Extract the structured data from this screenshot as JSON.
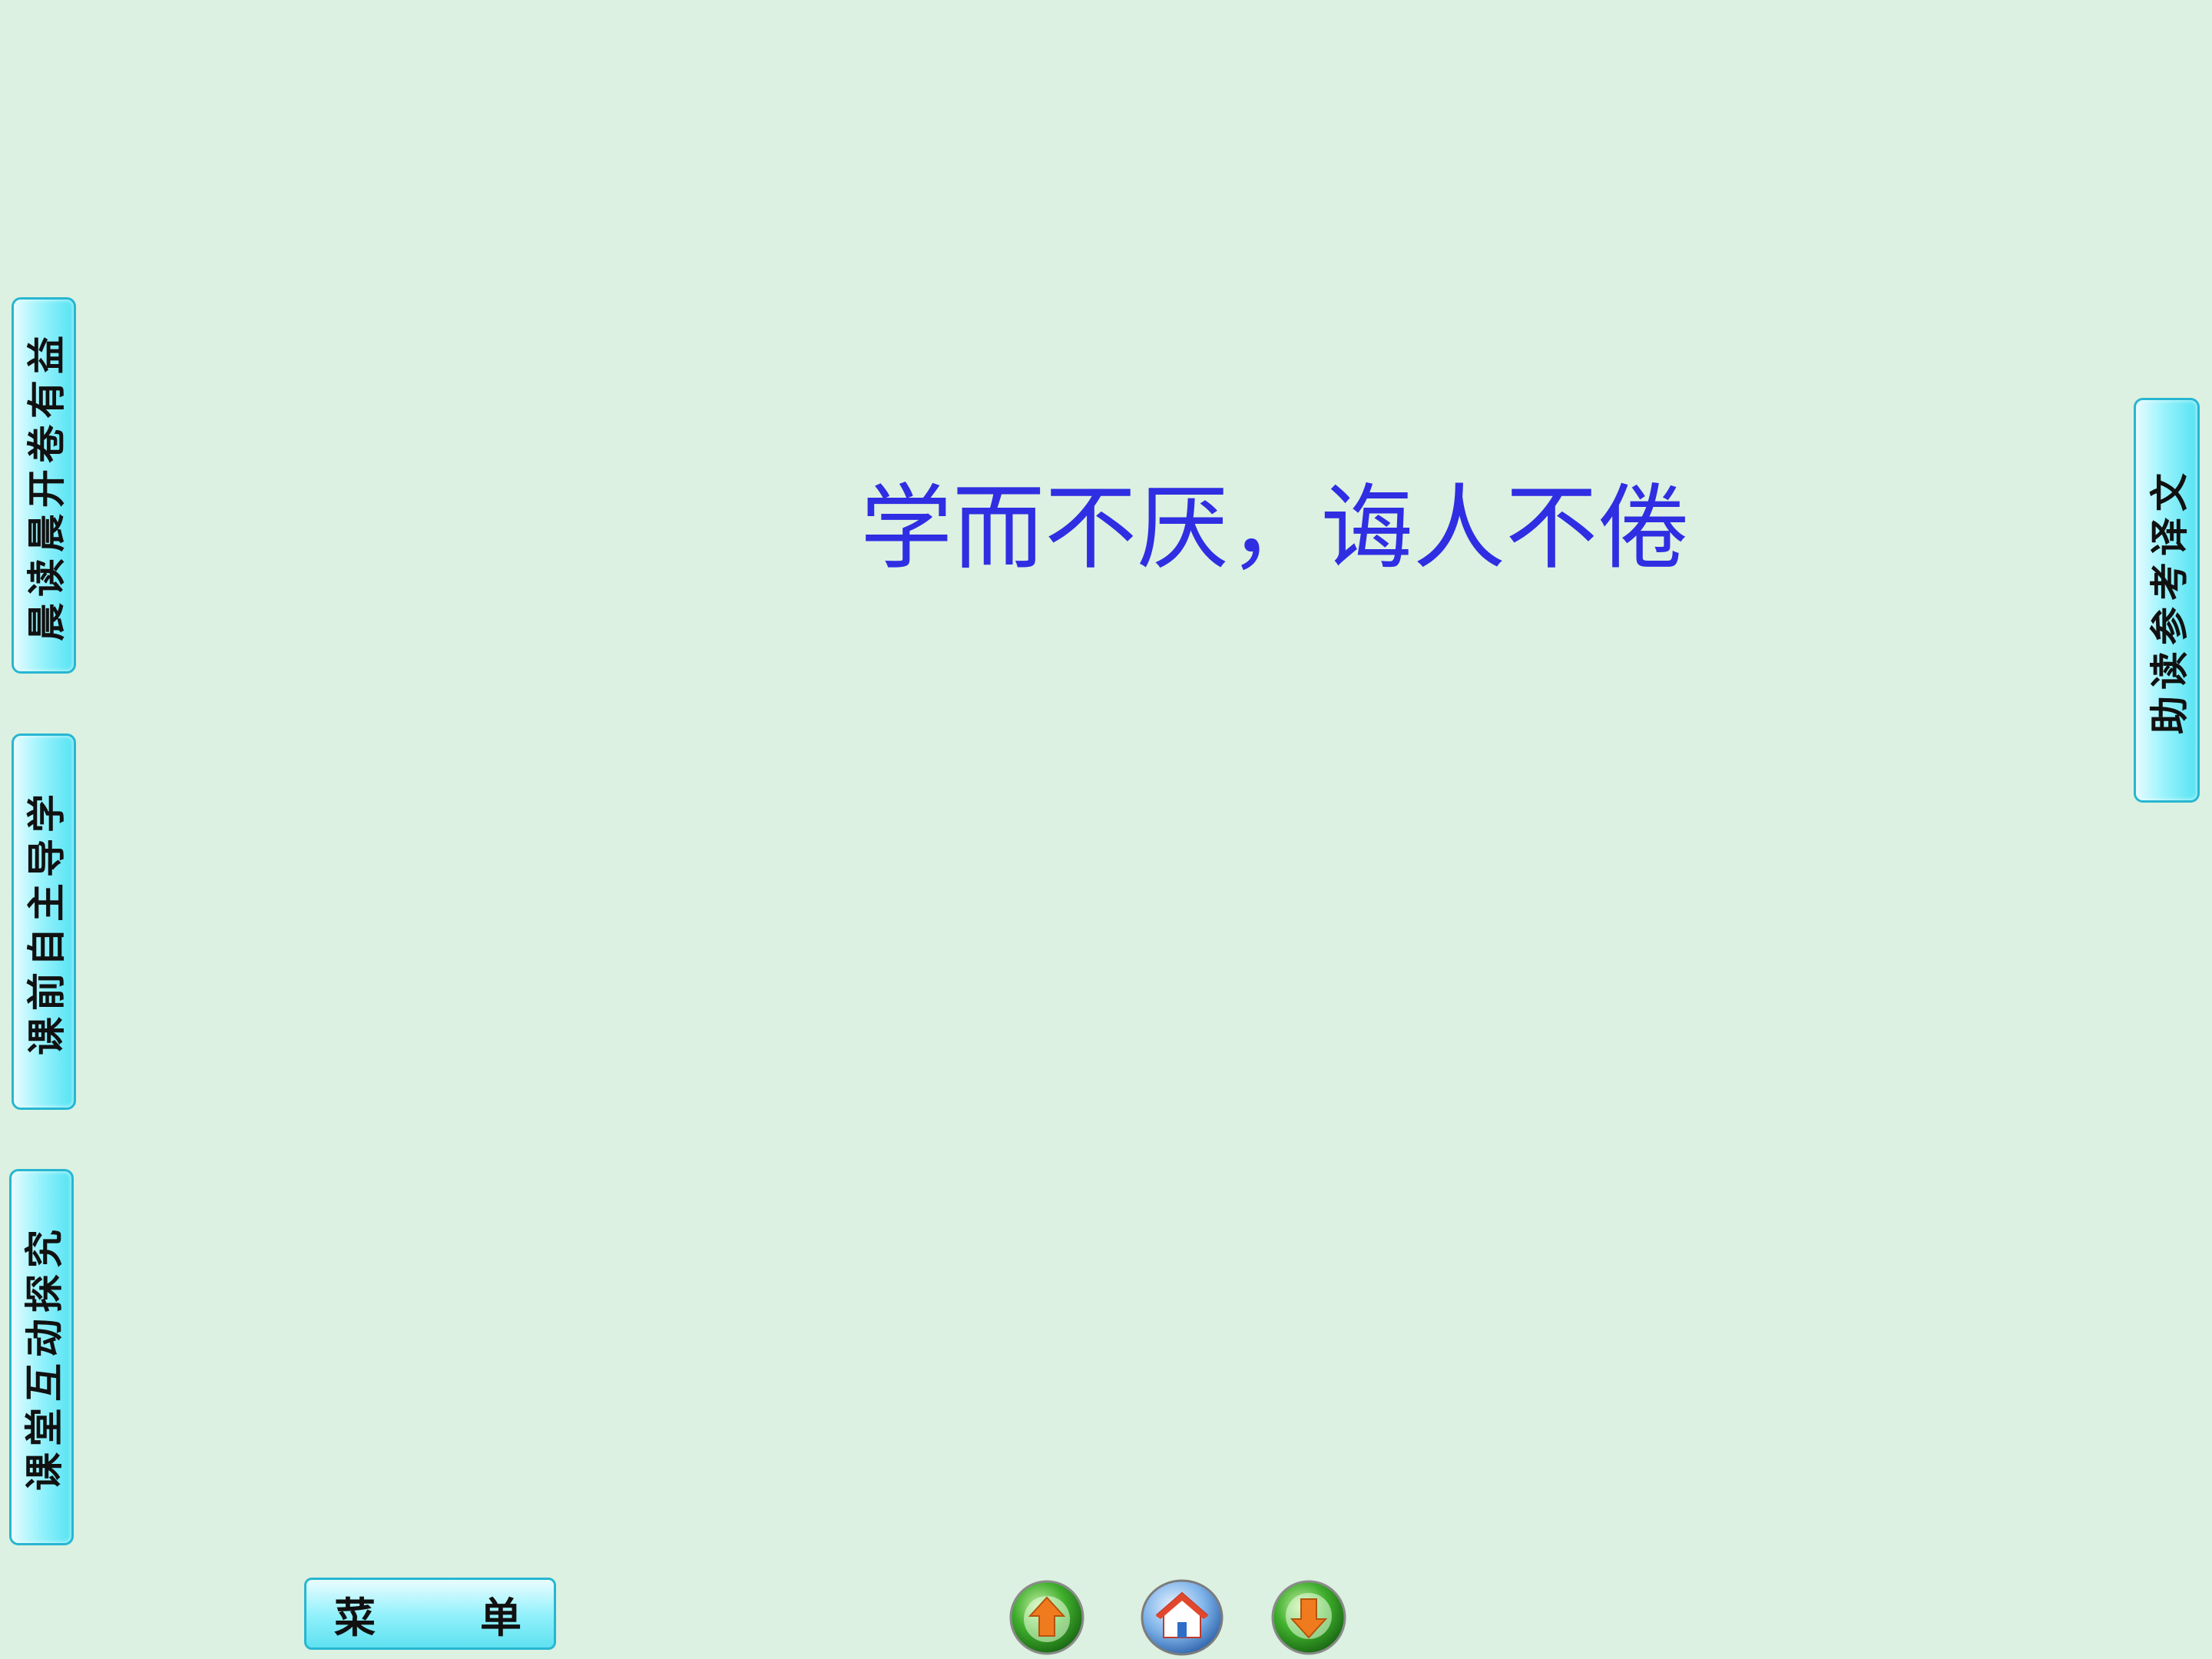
{
  "left_tabs": [
    {
      "label": "晨读晨开卷有益"
    },
    {
      "label": "课前自主导学"
    },
    {
      "label": "课堂互动探究"
    }
  ],
  "right_tabs": [
    {
      "label": "助读参考译文"
    }
  ],
  "main": {
    "title": "学而不厌，诲人不倦"
  },
  "bottom_bar": {
    "menu_label_left": "菜",
    "menu_label_right": "单",
    "nav_buttons": [
      {
        "icon": "up-arrow-icon",
        "color": "#f07a1e"
      },
      {
        "icon": "home-icon",
        "color": "#3a7fd6"
      },
      {
        "icon": "down-arrow-icon",
        "color": "#f07a1e"
      }
    ]
  },
  "colors": {
    "background": "#dcf1e1",
    "title_text": "#2f2ee2",
    "tab_border": "#27b6d2",
    "tab_fill": "#8ef0fb"
  }
}
